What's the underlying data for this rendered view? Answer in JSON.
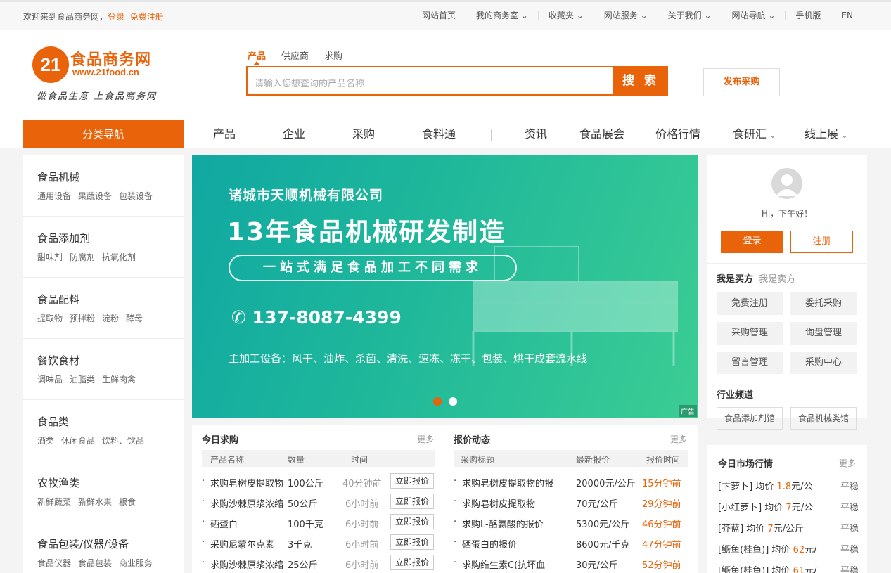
{
  "topbar": {
    "welcome": "欢迎来到食品商务网，",
    "login": "登录",
    "register": "免费注册",
    "links": [
      "网站首页",
      "我的商务室",
      "收藏夹",
      "网站服务",
      "关于我们",
      "网站导航",
      "手机版",
      "EN"
    ]
  },
  "logo": {
    "num": "21",
    "name": "食品商务网",
    "url": "www.21food.cn",
    "slogan": "做食品生意 上食品商务网"
  },
  "search": {
    "tabs": [
      "产品",
      "供应商",
      "求购"
    ],
    "placeholder": "请输入您想查询的产品名称",
    "button": "搜 索"
  },
  "publish": "发布采购",
  "nav": {
    "category": "分类导航",
    "items": [
      "产品",
      "企业",
      "采购",
      "食料通",
      "资讯",
      "食品展会",
      "价格行情",
      "食研汇",
      "线上展"
    ]
  },
  "categories": [
    {
      "title": "食品机械",
      "subs": [
        "通用设备",
        "果蔬设备",
        "包装设备"
      ]
    },
    {
      "title": "食品添加剂",
      "subs": [
        "甜味剂",
        "防腐剂",
        "抗氧化剂"
      ]
    },
    {
      "title": "食品配料",
      "subs": [
        "提取物",
        "预拌粉",
        "淀粉",
        "酵母"
      ]
    },
    {
      "title": "餐饮食材",
      "subs": [
        "调味品",
        "油脂类",
        "生鲜肉禽"
      ]
    },
    {
      "title": "食品类",
      "subs": [
        "酒类",
        "休闲食品",
        "饮料、饮品"
      ]
    },
    {
      "title": "农牧渔类",
      "subs": [
        "新鲜蔬菜",
        "新鲜水果",
        "粮食"
      ]
    },
    {
      "title": "食品包装/仪器/设备",
      "subs": [
        "食品仪器",
        "食品包装",
        "商业服务"
      ]
    }
  ],
  "banner": {
    "company": "诸城市天顺机械有限公司",
    "headline": "13年食品机械研发制造",
    "tagline": "一站式满足食品加工不同需求",
    "phone": "137-8087-4399",
    "equip": "主加工设备：风干、油炸、杀菌、清洗、速冻、冻干、包装、烘干成套流水线",
    "ad": "广告"
  },
  "purchase": {
    "title": "今日求购",
    "more": "更多",
    "headers": [
      "产品名称",
      "数量",
      "时间"
    ],
    "rows": [
      {
        "name": "求购皂树皮提取物",
        "qty": "100公斤",
        "time": "40分钟前",
        "btn": "立即报价"
      },
      {
        "name": "求购沙棘原浆浓缩",
        "qty": "50公斤",
        "time": "6小时前",
        "btn": "立即报价"
      },
      {
        "name": "硒蛋白",
        "qty": "100千克",
        "time": "6小时前",
        "btn": "立即报价"
      },
      {
        "name": "采购尼蒙尔克素",
        "qty": "3千克",
        "time": "6小时前",
        "btn": "立即报价"
      },
      {
        "name": "求购沙棘原浆浓缩",
        "qty": "25公斤",
        "time": "6小时前",
        "btn": "立即报价"
      }
    ]
  },
  "quotes": {
    "title": "报价动态",
    "more": "更多",
    "headers": [
      "采购标题",
      "最新报价",
      "报价时间"
    ],
    "rows": [
      {
        "name": "求购皂树皮提取物的报",
        "price": "20000元/公斤",
        "time": "15分钟前"
      },
      {
        "name": "求购皂树皮提取物",
        "price": "70元/公斤",
        "time": "29分钟前"
      },
      {
        "name": "求购L-酪氨酸的报价",
        "price": "5300元/公斤",
        "time": "46分钟前"
      },
      {
        "name": "硒蛋白的报价",
        "price": "8600元/千克",
        "time": "47分钟前"
      },
      {
        "name": "求购维生素C(抗坏血",
        "price": "30元/公斤",
        "time": "52分钟前"
      }
    ]
  },
  "user": {
    "greeting": "Hi，下午好！",
    "login": "登录",
    "register": "注册",
    "tab_buyer": "我是买方",
    "tab_seller": "我是卖方",
    "actions": [
      "免费注册",
      "委托采购",
      "采购管理",
      "询盘管理",
      "留言管理",
      "采购中心"
    ],
    "industry_title": "行业频道",
    "industry": [
      "食品添加剂馆",
      "食品机械类馆"
    ]
  },
  "market": {
    "title": "今日市场行情",
    "more": "更多",
    "rows": [
      {
        "name": "[卞萝卜] 均价 ",
        "price": "1.8",
        "unit": "元/公",
        "trend": "平稳"
      },
      {
        "name": "[小红萝卜] 均价 ",
        "price": "7",
        "unit": "元/公",
        "trend": "平稳"
      },
      {
        "name": "[芥蓝] 均价 ",
        "price": "7",
        "unit": "元/公斤",
        "trend": "平稳"
      },
      {
        "name": "[鳜鱼(桂鱼)] 均价 ",
        "price": "62",
        "unit": "元/",
        "trend": "平稳"
      },
      {
        "name": "[鳜鱼(桂鱼)] 均价 ",
        "price": "61",
        "unit": "元/",
        "trend": "平稳"
      }
    ]
  },
  "colors": {
    "accent": "#e8630a"
  }
}
